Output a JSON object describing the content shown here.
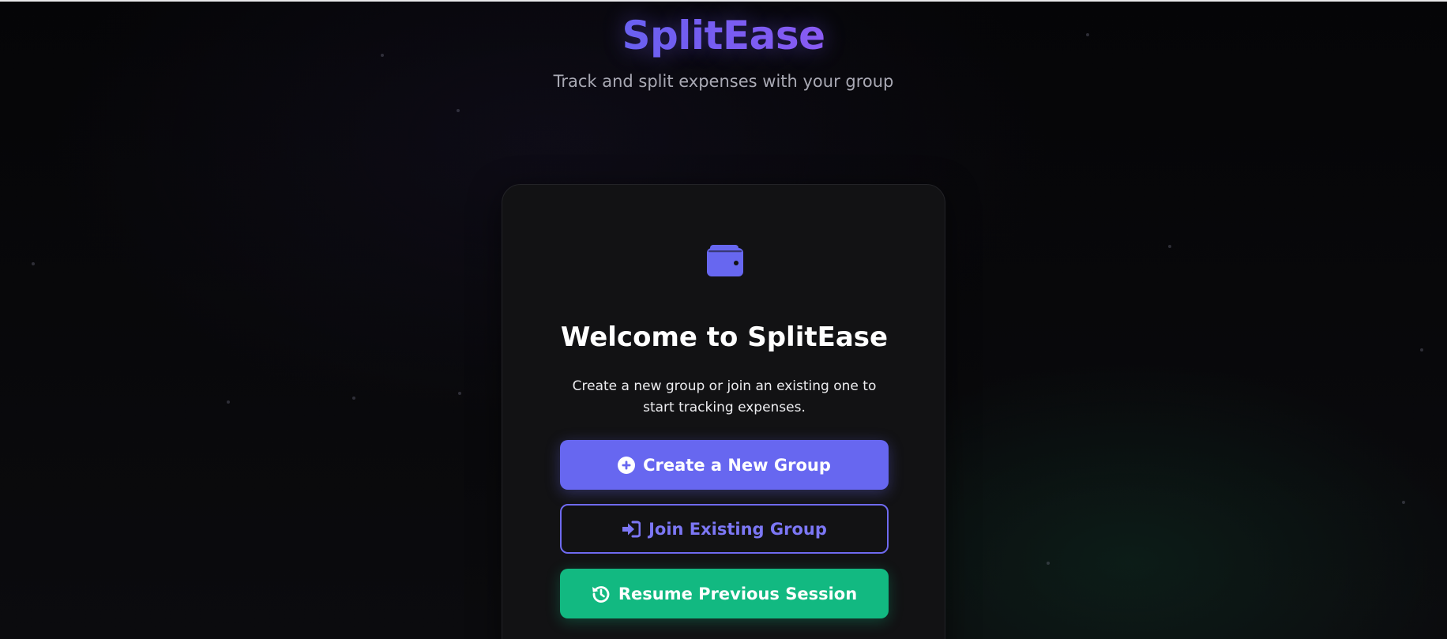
{
  "header": {
    "title": "SplitEase",
    "subtitle": "Track and split expenses with your group"
  },
  "card": {
    "icon": "wallet-icon",
    "title": "Welcome to SplitEase",
    "description": "Create a new group or join an existing one to start tracking expenses."
  },
  "actions": {
    "create": {
      "label": "Create a New Group",
      "icon": "plus-circle-icon"
    },
    "join": {
      "label": "Join Existing Group",
      "icon": "sign-in-icon"
    },
    "resume": {
      "label": "Resume Previous Session",
      "icon": "history-icon"
    }
  },
  "colors": {
    "primary": "#6767f0",
    "success": "#12b981",
    "background": "#0a0a0c",
    "card": "#121214"
  }
}
